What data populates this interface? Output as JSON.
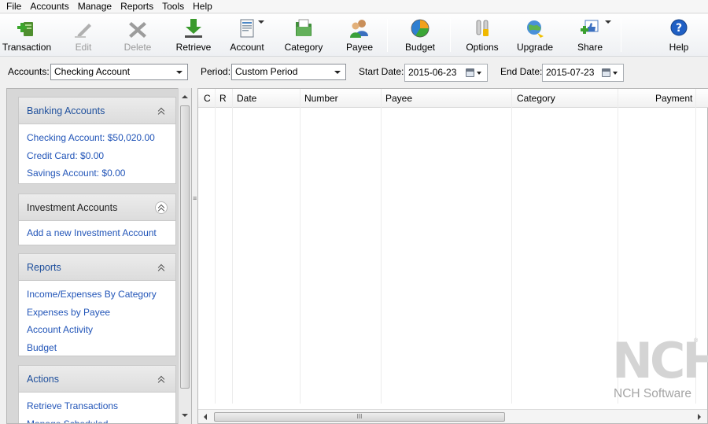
{
  "menu": [
    "File",
    "Accounts",
    "Manage",
    "Reports",
    "Tools",
    "Help"
  ],
  "toolbar": {
    "transaction": "Transaction",
    "edit": "Edit",
    "delete": "Delete",
    "retrieve": "Retrieve",
    "account": "Account",
    "category": "Category",
    "payee": "Payee",
    "budget": "Budget",
    "options": "Options",
    "upgrade": "Upgrade",
    "share": "Share",
    "help": "Help"
  },
  "filters": {
    "accounts_label": "Accounts:",
    "accounts_value": "Checking Account",
    "period_label": "Period:",
    "period_value": "Custom Period",
    "start_label": "Start Date:",
    "start_value": "2015-06-23",
    "end_label": "End Date:",
    "end_value": "2015-07-23"
  },
  "sidebar": {
    "banking": {
      "title": "Banking Accounts",
      "items": [
        "Checking Account: $50,020.00",
        "Credit Card: $0.00",
        "Savings Account: $0.00"
      ]
    },
    "investment": {
      "title": "Investment Accounts",
      "items": [
        "Add a new Investment Account"
      ]
    },
    "reports": {
      "title": "Reports",
      "items": [
        "Income/Expenses By Category",
        "Expenses by Payee",
        "Account Activity",
        "Budget"
      ]
    },
    "actions": {
      "title": "Actions",
      "items": [
        "Retrieve Transactions",
        "Manage Scheduled"
      ]
    }
  },
  "grid": {
    "columns": [
      "C",
      "R",
      "Date",
      "Number",
      "Payee",
      "Category",
      "Payment"
    ]
  },
  "logo": {
    "letters": "NCH",
    "registered": "®",
    "text": "NCH Software"
  },
  "scrollbar": {
    "grip": "III"
  }
}
